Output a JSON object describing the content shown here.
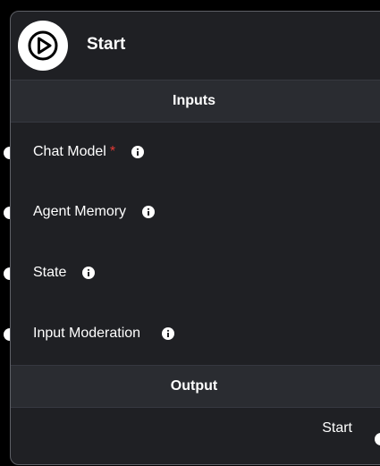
{
  "node": {
    "title": "Start",
    "icon": "play-icon"
  },
  "inputs": {
    "section_label": "Inputs",
    "params": [
      {
        "label": "Chat Model",
        "required": true,
        "required_mark": "*",
        "info_icon": "info-icon"
      },
      {
        "label": "Agent Memory",
        "required": false,
        "info_icon": "info-icon"
      },
      {
        "label": "State",
        "required": false,
        "info_icon": "info-icon"
      },
      {
        "label": "Input Moderation",
        "required": false,
        "info_icon": "info-icon"
      }
    ]
  },
  "output": {
    "section_label": "Output",
    "label": "Start"
  },
  "colors": {
    "node_bg": "#1f2024",
    "section_bg": "#2a2c31",
    "border": "#5d5f66",
    "required": "#e53935",
    "text": "#ffffff"
  }
}
